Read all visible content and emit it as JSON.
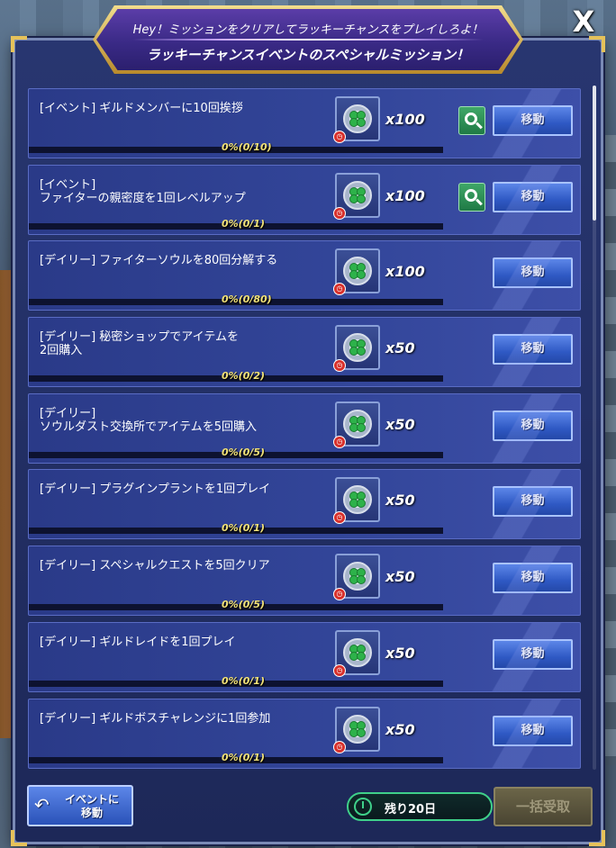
{
  "header": {
    "subtitle": "Hey！ミッションをクリアしてラッキーチャンスをプレイしろよ！",
    "title": "ラッキーチャンスイベントのスペシャルミッション！"
  },
  "close_label": "X",
  "missions": [
    {
      "title": "[イベント] ギルドメンバーに10回挨拶",
      "progress_text": "0%(0/10)",
      "progress": 0,
      "reward_qty": "x100",
      "has_search": true,
      "move_label": "移動"
    },
    {
      "title": "[イベント]\nファイターの親密度を1回レベルアップ",
      "progress_text": "0%(0/1)",
      "progress": 0,
      "reward_qty": "x100",
      "has_search": true,
      "move_label": "移動"
    },
    {
      "title": "[デイリー] ファイターソウルを80回分解する",
      "progress_text": "0%(0/80)",
      "progress": 0,
      "reward_qty": "x100",
      "has_search": false,
      "move_label": "移動"
    },
    {
      "title": "[デイリー] 秘密ショップでアイテムを\n2回購入",
      "progress_text": "0%(0/2)",
      "progress": 0,
      "reward_qty": "x50",
      "has_search": false,
      "move_label": "移動"
    },
    {
      "title": "[デイリー]\nソウルダスト交換所でアイテムを5回購入",
      "progress_text": "0%(0/5)",
      "progress": 0,
      "reward_qty": "x50",
      "has_search": false,
      "move_label": "移動"
    },
    {
      "title": "[デイリー] プラグインプラントを1回プレイ",
      "progress_text": "0%(0/1)",
      "progress": 0,
      "reward_qty": "x50",
      "has_search": false,
      "move_label": "移動"
    },
    {
      "title": "[デイリー] スペシャルクエストを5回クリア",
      "progress_text": "0%(0/5)",
      "progress": 0,
      "reward_qty": "x50",
      "has_search": false,
      "move_label": "移動"
    },
    {
      "title": "[デイリー] ギルドレイドを1回プレイ",
      "progress_text": "0%(0/1)",
      "progress": 0,
      "reward_qty": "x50",
      "has_search": false,
      "move_label": "移動"
    },
    {
      "title": "[デイリー] ギルドボスチャレンジに1回参加",
      "progress_text": "0%(0/1)",
      "progress": 0,
      "reward_qty": "x50",
      "has_search": false,
      "move_label": "移動"
    }
  ],
  "footer": {
    "event_button": "イベントに\n移動",
    "remaining": "残り20日",
    "claim_all": "一括受取"
  },
  "colors": {
    "panel": "#283670",
    "row": "#33469a",
    "move_button": "#2f59c4",
    "search_button": "#2e9b57",
    "progress_text": "#f2e278",
    "timer_border": "#3fd08a",
    "header_gold": "#e6c25a"
  },
  "icons": {
    "reward": "clover-medal-icon",
    "time_limited": "clock-icon",
    "search": "search-icon",
    "back": "back-arrow-icon",
    "timer": "clock-icon"
  }
}
